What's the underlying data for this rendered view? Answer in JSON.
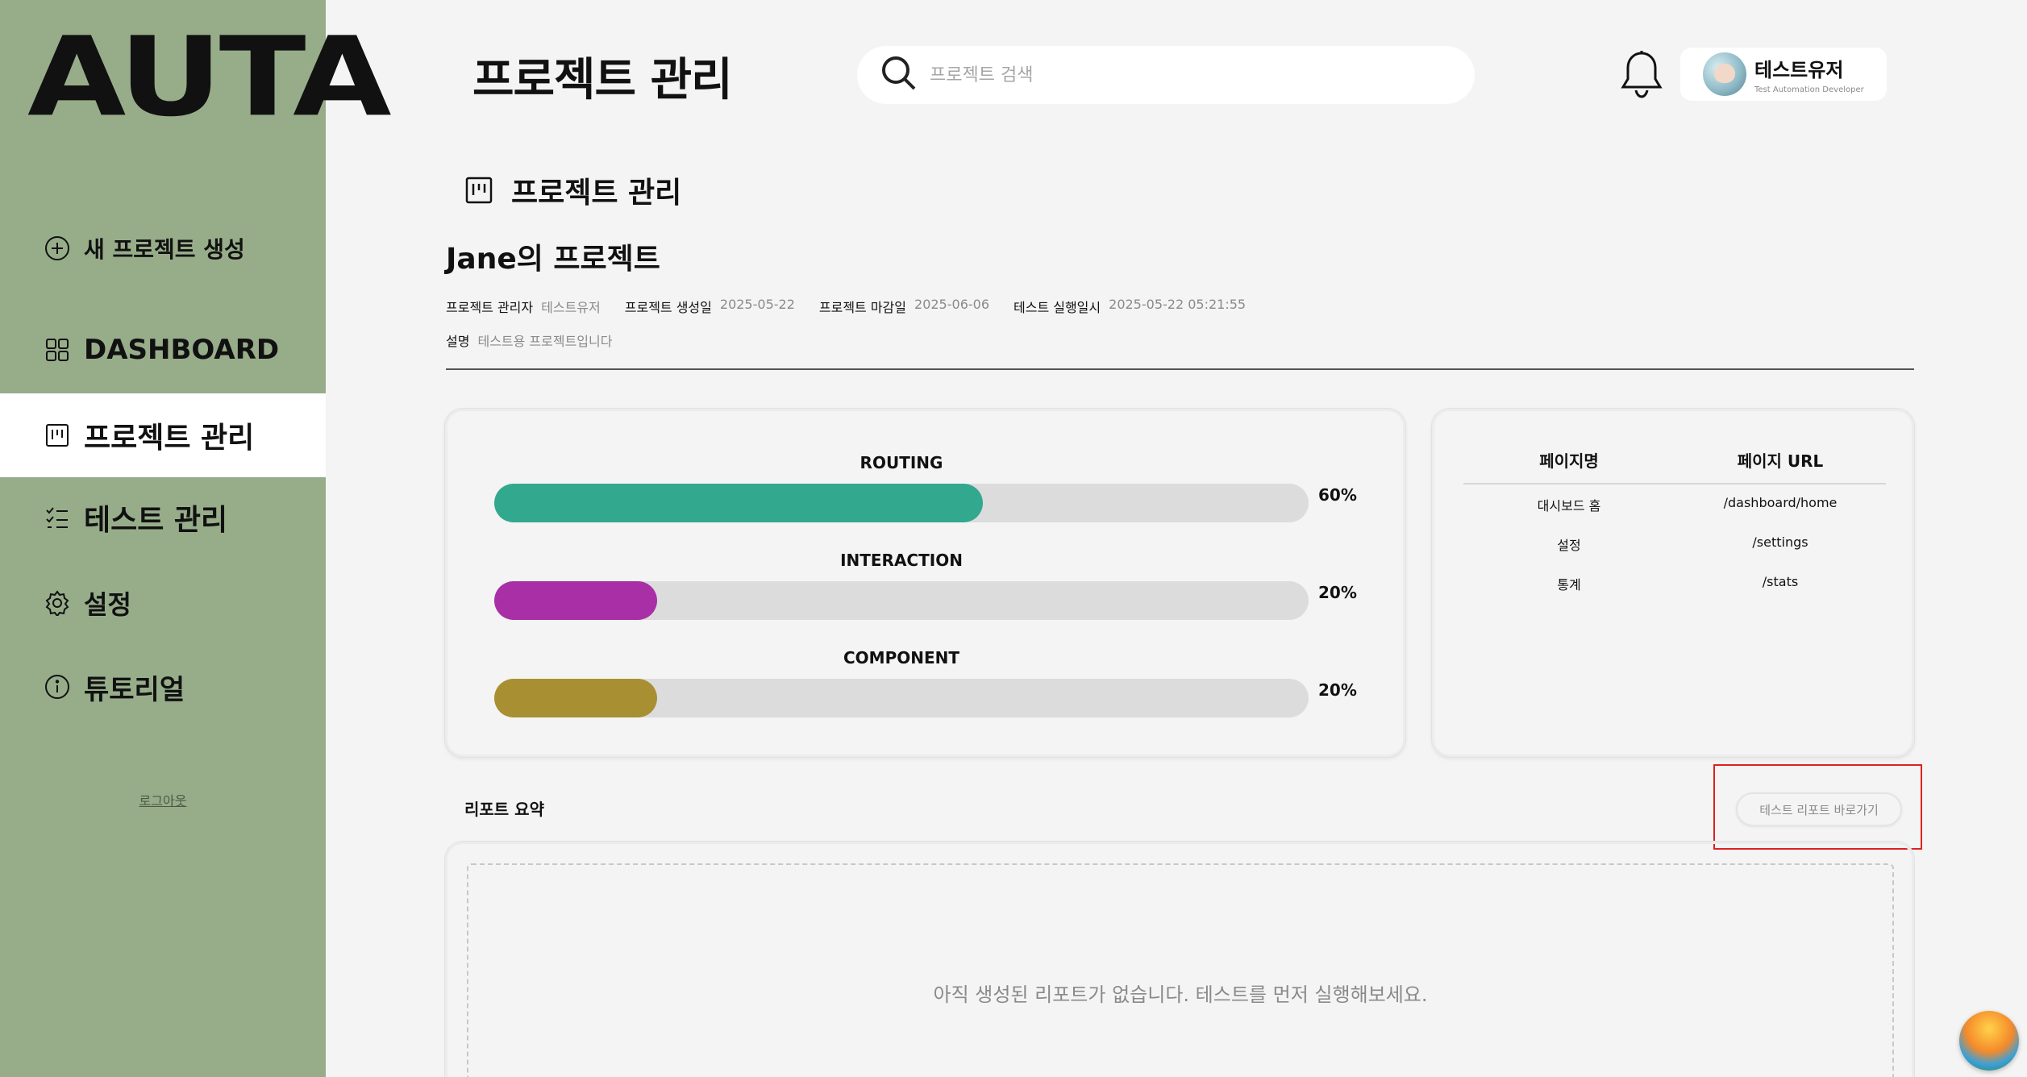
{
  "sidebar": {
    "logo": "AUTA",
    "items": [
      {
        "label": "새 프로젝트 생성",
        "icon": "plus-circle-icon"
      },
      {
        "label": "DASHBOARD",
        "icon": "grid-icon"
      },
      {
        "label": "프로젝트 관리",
        "icon": "kanban-icon"
      },
      {
        "label": "테스트 관리",
        "icon": "checklist-icon"
      },
      {
        "label": "설정",
        "icon": "gear-icon"
      },
      {
        "label": "튜토리얼",
        "icon": "info-icon"
      }
    ],
    "logout": "로그아웃"
  },
  "header": {
    "title": "프로젝트 관리",
    "search_placeholder": "프로젝트 검색",
    "user_name": "테스트유저",
    "user_role": "Test Automation Developer"
  },
  "section": {
    "title": "프로젝트 관리",
    "project_name": "Jane의 프로젝트",
    "meta": {
      "manager_label": "프로젝트 관리자",
      "manager_value": "테스트유저",
      "created_label": "프로젝트 생성일",
      "created_value": "2025-05-22",
      "deadline_label": "프로젝트 마감일",
      "deadline_value": "2025-06-06",
      "run_label": "테스트 실행일시",
      "run_value": "2025-05-22 05:21:55",
      "desc_label": "설명",
      "desc_value": "테스트용 프로젝트입니다"
    }
  },
  "progress": [
    {
      "name": "ROUTING",
      "value": 60,
      "label": "60%",
      "color": "#32a88f"
    },
    {
      "name": "INTERACTION",
      "value": 20,
      "label": "20%",
      "color": "#a82fa6"
    },
    {
      "name": "COMPONENT",
      "value": 20,
      "label": "20%",
      "color": "#a88f32"
    }
  ],
  "pages": {
    "col_name": "페이지명",
    "col_url": "페이지 URL",
    "rows": [
      {
        "name": "대시보드 홈",
        "url": "/dashboard/home"
      },
      {
        "name": "설정",
        "url": "/settings"
      },
      {
        "name": "통계",
        "url": "/stats"
      }
    ]
  },
  "report": {
    "label": "리포트 요약",
    "button": "테스트 리포트 바로가기",
    "empty": "아직 생성된 리포트가 없습니다. 테스트를 먼저 실행해보세요."
  }
}
